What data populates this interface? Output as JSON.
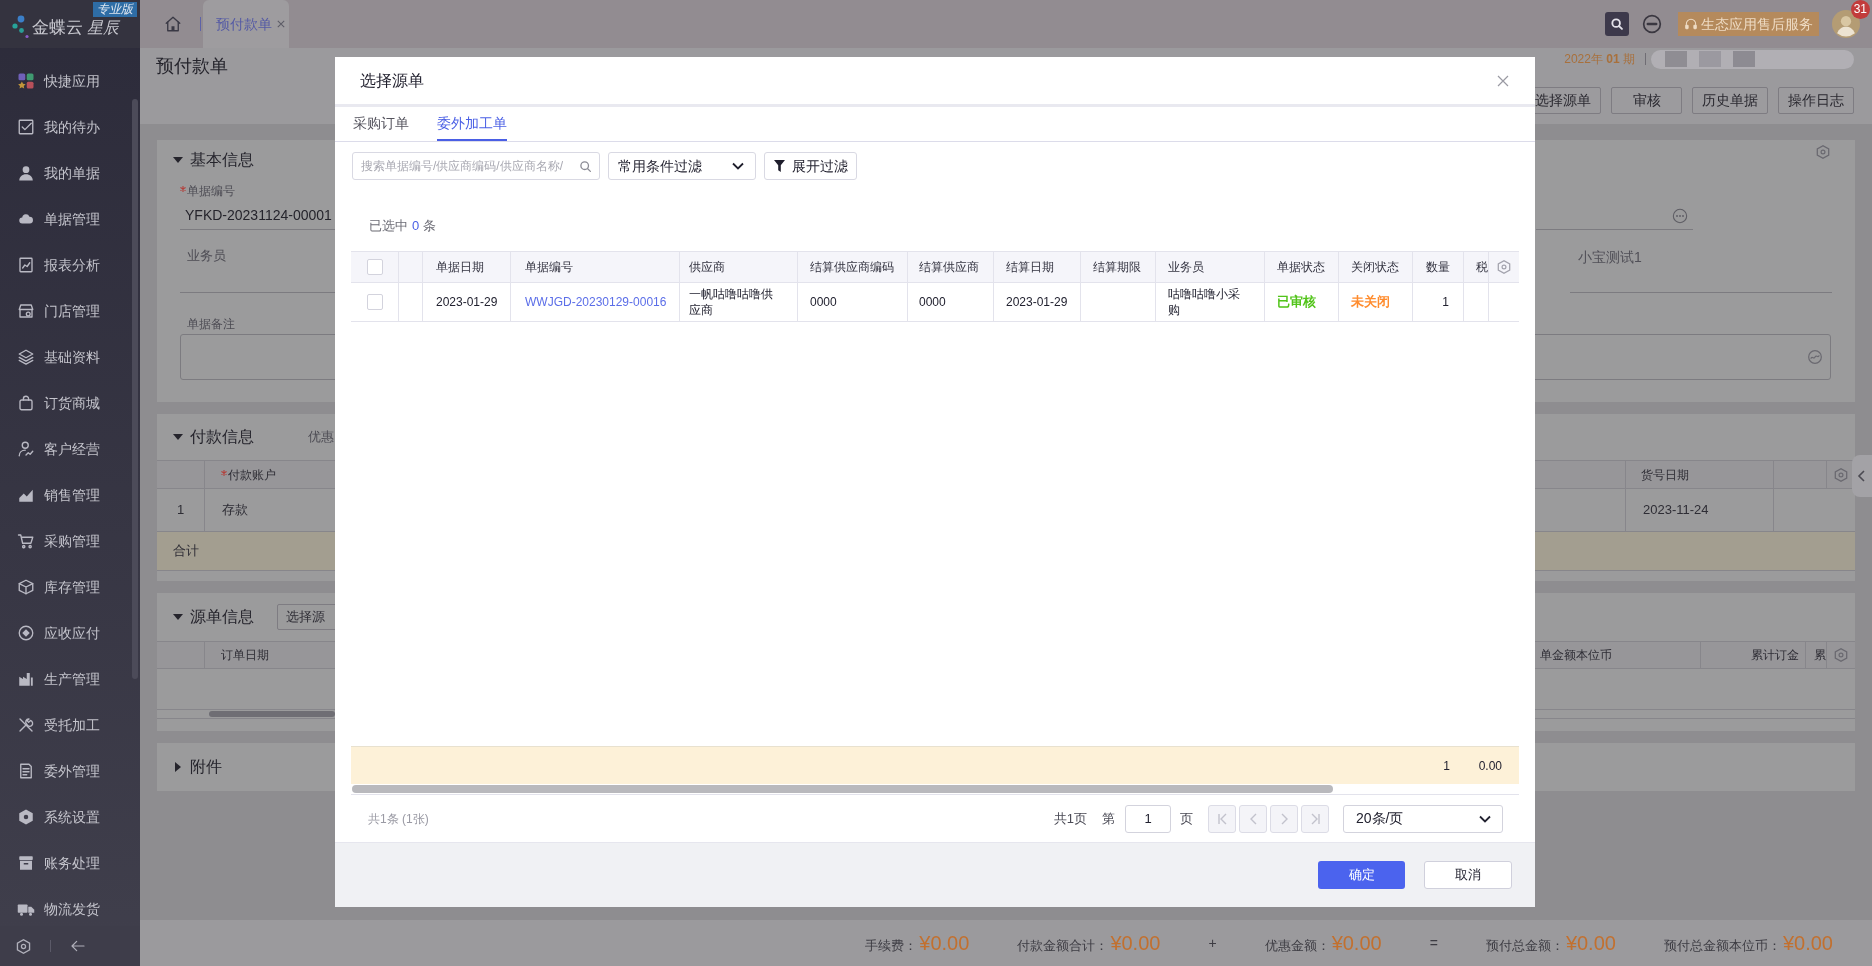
{
  "sidebar": {
    "brand": "金蝶云",
    "brand_suffix": "星辰",
    "edition": "专业版",
    "items": [
      {
        "label": "快捷应用"
      },
      {
        "label": "我的待办"
      },
      {
        "label": "我的单据"
      },
      {
        "label": "单据管理"
      },
      {
        "label": "报表分析"
      },
      {
        "label": "门店管理"
      },
      {
        "label": "基础资料"
      },
      {
        "label": "订货商城"
      },
      {
        "label": "客户经营"
      },
      {
        "label": "销售管理"
      },
      {
        "label": "采购管理"
      },
      {
        "label": "库存管理"
      },
      {
        "label": "应收应付"
      },
      {
        "label": "生产管理"
      },
      {
        "label": "受托加工"
      },
      {
        "label": "委外管理"
      },
      {
        "label": "系统设置"
      },
      {
        "label": "账务处理"
      },
      {
        "label": "物流发货"
      }
    ]
  },
  "header": {
    "tabs": [
      {
        "label": "预付款单",
        "selected": true
      }
    ],
    "service_button": "生态应用售后服务",
    "notification_count": "31"
  },
  "page": {
    "title": "预付款单",
    "period": "2022年 **01** 期",
    "actions": [
      "选择源单",
      "审核",
      "历史单据",
      "操作日志"
    ]
  },
  "basic_info": {
    "title": "基本信息",
    "expanded": true,
    "doc_number": {
      "label": "单据编号",
      "required": true,
      "value": "YFKD-20231124-00001"
    },
    "salesperson": {
      "label": "业务员",
      "required": false
    },
    "right_field": {
      "value": "小宝测试1"
    },
    "remark": {
      "label": "单据备注"
    }
  },
  "payment_info": {
    "title": "付款信息",
    "expanded": true,
    "discount_label": "优惠",
    "columns": [
      {
        "label": "付款账户",
        "required": true
      },
      {
        "label": "货号日期",
        "required": false
      }
    ],
    "rows": [
      {
        "index": "1",
        "account": "存款",
        "date": "2023-11-24"
      }
    ],
    "total_label": "合计"
  },
  "source_info": {
    "title": "源单信息",
    "expanded": true,
    "select_button": "选择源",
    "columns": [
      "订单日期",
      "单金额本位币",
      "累计订金",
      "累"
    ]
  },
  "attachments": {
    "title": "附件",
    "expanded": false
  },
  "totals": [
    {
      "kind": "amount",
      "label": "手续费：",
      "value": "¥0.00"
    },
    {
      "kind": "amount",
      "label": "付款金额合计：",
      "value": "¥0.00"
    },
    {
      "kind": "operator",
      "symbol": "+"
    },
    {
      "kind": "amount",
      "label": "优惠金额：",
      "value": "¥0.00"
    },
    {
      "kind": "operator",
      "symbol": "="
    },
    {
      "kind": "amount",
      "label": "预付总金额：",
      "value": "¥0.00"
    },
    {
      "kind": "amount",
      "label": "预付总金额本位币：",
      "value": "¥0.00"
    }
  ],
  "dialog": {
    "title": "选择源单",
    "tabs": [
      {
        "label": "采购订单",
        "selected": false
      },
      {
        "label": "委外加工单",
        "selected": true
      }
    ],
    "search": {
      "placeholder": "搜索单据编号/供应商编码/供应商名称/"
    },
    "filter_select": "常用条件过滤",
    "expand_filter_button": "展开过滤",
    "selection": {
      "prefix": "已选中",
      "count": "0",
      "suffix": "条"
    },
    "table": {
      "header_checked": false,
      "columns": [
        {
          "label": "单据日期",
          "kind": "text"
        },
        {
          "label": "单据编号",
          "kind": "link"
        },
        {
          "label": "供应商",
          "kind": "text"
        },
        {
          "label": "结算供应商编码",
          "kind": "text"
        },
        {
          "label": "结算供应商",
          "kind": "text"
        },
        {
          "label": "结算日期",
          "kind": "text"
        },
        {
          "label": "结算期限",
          "kind": "text"
        },
        {
          "label": "业务员",
          "kind": "text"
        },
        {
          "label": "单据状态",
          "kind": "text"
        },
        {
          "label": "关闭状态",
          "kind": "text"
        },
        {
          "label": "数量",
          "kind": "number"
        },
        {
          "label": "税",
          "kind": "text"
        }
      ],
      "rows": [
        {
          "checked": false,
          "cells": [
            {
              "text": "2023-01-29"
            },
            {
              "text": "WWJGD-20230129-00016"
            },
            {
              "text": "一帆咕噜咕噜供应商"
            },
            {
              "text": "0000"
            },
            {
              "text": "0000"
            },
            {
              "text": "2023-01-29"
            },
            null,
            {
              "text": "咕噜咕噜小采购"
            },
            {
              "text": "已审核",
              "color": "#52c41a"
            },
            {
              "text": "未关闭",
              "color": "#ff8c2e"
            },
            {
              "text": "1"
            },
            null
          ]
        }
      ],
      "totals": [
        "1",
        "0.00"
      ]
    },
    "pagination": {
      "summary": "共1条 (1张)",
      "pages": "共1页",
      "page_prefix": "第",
      "page": "1",
      "page_suffix": "页",
      "nav_buttons": [
        {
          "disabled": true
        },
        {
          "disabled": true
        },
        {
          "disabled": true
        },
        {
          "disabled": true
        }
      ],
      "page_size": "20条/页"
    },
    "buttons": [
      {
        "label": "确定",
        "kind": "primary"
      },
      {
        "label": "取消",
        "kind": "default"
      }
    ]
  }
}
